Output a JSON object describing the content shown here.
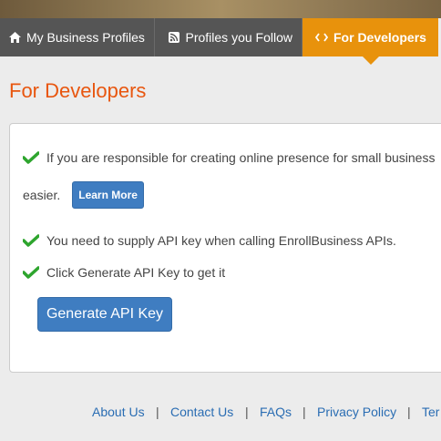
{
  "tabs": [
    {
      "label": "My Business Profiles",
      "icon": "home-icon"
    },
    {
      "label": "Profiles you Follow",
      "icon": "rss-icon"
    },
    {
      "label": "For Developers",
      "icon": "code-icon",
      "active": true
    }
  ],
  "page": {
    "title": "For Developers"
  },
  "panel": {
    "line1": "If you are responsible for creating online presence for small business",
    "line1_cont": "easier.",
    "learn_more": "Learn More",
    "line2": "You need to supply API key when calling EnrollBusiness APIs.",
    "line3": "Click Generate API Key to get it",
    "generate_button": "Generate API Key"
  },
  "footer": {
    "links": [
      "About Us",
      "Contact Us",
      "FAQs",
      "Privacy Policy",
      "Ter"
    ],
    "separator": "|"
  },
  "colors": {
    "accent_orange": "#e8920c",
    "title_orange": "#e8560f",
    "tab_gray": "#555555",
    "button_blue": "#3f7dc1",
    "check_green": "#2ea52e",
    "link_blue": "#2a6db3"
  }
}
